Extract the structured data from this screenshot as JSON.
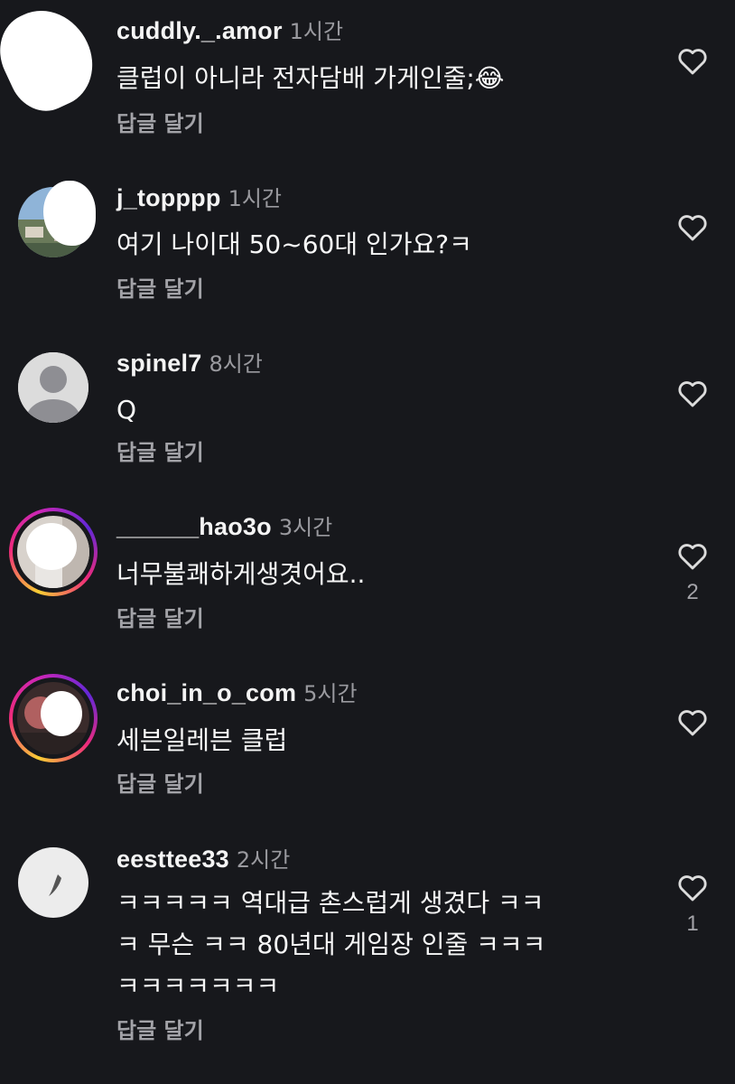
{
  "colors": {
    "background": "#17181c",
    "username": "#f4f4f4",
    "secondary": "#a3a3a8",
    "ring_gradient": [
      "#f9ce34",
      "#ee2a7b",
      "#6228d7"
    ]
  },
  "comments": [
    {
      "username": "cuddly._.amor",
      "time": "1시간",
      "text": "클럽이 아니라 전자담배 가게인줄;😂",
      "reply": "답글 달기",
      "like_icon": "heart-outline-icon",
      "likes": ""
    },
    {
      "username": "j_topppp",
      "time": "1시간",
      "text": "여기 나이대 50~60대 인가요?ㅋ",
      "reply": "답글 달기",
      "like_icon": "heart-outline-icon",
      "likes": ""
    },
    {
      "username": "spinel7",
      "time": "8시간",
      "text": "Q",
      "reply": "답글 달기",
      "like_icon": "heart-outline-icon",
      "likes": ""
    },
    {
      "username": "______hao3o",
      "time": "3시간",
      "text": "너무불쾌하게생겻어요..",
      "reply": "답글 달기",
      "like_icon": "heart-outline-icon",
      "likes": "2"
    },
    {
      "username": "choi_in_o_com",
      "time": "5시간",
      "text": "세븐일레븐 클럽",
      "reply": "답글 달기",
      "like_icon": "heart-outline-icon",
      "likes": ""
    },
    {
      "username": "eesttee33",
      "time": "2시간",
      "text": "ㅋㅋㅋㅋㅋ 역대급 촌스럽게 생겼다 ㅋㅋ\nㅋ 무슨 ㅋㅋ 80년대 게임장 인줄 ㅋㅋㅋ\nㅋㅋㅋㅋㅋㅋㅋ",
      "reply": "답글 달기",
      "like_icon": "heart-outline-icon",
      "likes": "1"
    }
  ]
}
